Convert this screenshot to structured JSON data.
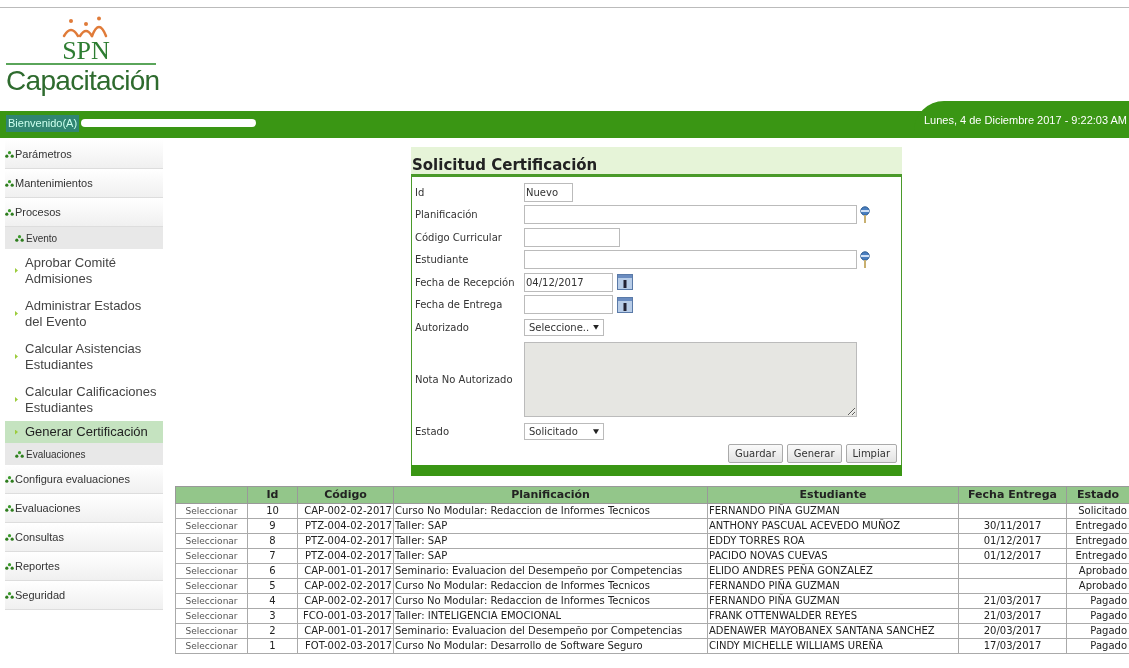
{
  "header": {
    "logo_mark": "SPN",
    "logo_title": "Capacitación",
    "welcome": "Bienvenido(A)",
    "date_time": "Lunes, 4 de Diciembre 2017 - 9:22:03 AM"
  },
  "sidebar": {
    "items": [
      {
        "label": "Parámetros",
        "kind": "group"
      },
      {
        "label": "Mantenimientos",
        "kind": "group"
      },
      {
        "label": "Procesos",
        "kind": "group",
        "children": [
          {
            "label": "Evento",
            "kind": "subgroup",
            "children": [
              {
                "label": "Aprobar Comité Admisiones",
                "kind": "leaf",
                "selected": false
              },
              {
                "label": "Administrar Estados del Evento",
                "kind": "leaf",
                "selected": false
              },
              {
                "label": "Calcular Asistencias Estudiantes",
                "kind": "leaf",
                "selected": false
              },
              {
                "label": "Calcular Calificaciones Estudiantes",
                "kind": "leaf",
                "selected": false
              },
              {
                "label": "Generar Certificación",
                "kind": "leaf",
                "selected": true
              }
            ]
          },
          {
            "label": "Evaluaciones",
            "kind": "subgroup"
          }
        ]
      },
      {
        "label": "Configura evaluaciones",
        "kind": "group"
      },
      {
        "label": "Evaluaciones",
        "kind": "group"
      },
      {
        "label": "Consultas",
        "kind": "group"
      },
      {
        "label": "Reportes",
        "kind": "group"
      },
      {
        "label": "Seguridad",
        "kind": "group"
      }
    ]
  },
  "form": {
    "title": "Solicitud Certificación",
    "fields": [
      {
        "label": "Id",
        "kind": "short",
        "value": "Nuevo"
      },
      {
        "label": "Planificación",
        "kind": "lookup"
      },
      {
        "label": "Código Curricular",
        "kind": "medium"
      },
      {
        "label": "Estudiante",
        "kind": "lookup"
      },
      {
        "label": "Fecha de Recepción",
        "kind": "date",
        "value": "04/12/2017"
      },
      {
        "label": "Fecha de Entrega",
        "kind": "date"
      },
      {
        "label": "Autorizado",
        "kind": "select",
        "value": "Seleccione.."
      },
      {
        "label": "Nota No Autorizado",
        "kind": "textarea",
        "disabled": true
      },
      {
        "label": "Estado",
        "kind": "select",
        "value": "Solicitado"
      }
    ],
    "buttons": [
      "Guardar",
      "Generar",
      "Limpiar"
    ]
  },
  "table": {
    "columns": [
      "Id",
      "Código",
      "Planificación",
      "Estudiante",
      "Fecha Entrega",
      "Estado"
    ],
    "rows": [
      {
        "action": "Seleccionar",
        "cells": [
          "10",
          "CAP-002-02-2017",
          "Curso No Modular: Redaccion de Informes Tecnicos",
          "FERNANDO PIÑA GUZMAN",
          "",
          "Solicitado"
        ]
      },
      {
        "action": "Seleccionar",
        "cells": [
          "9",
          "PTZ-004-02-2017",
          "Taller: SAP",
          "ANTHONY PASCUAL ACEVEDO MUÑOZ",
          "30/11/2017",
          "Entregado"
        ]
      },
      {
        "action": "Seleccionar",
        "cells": [
          "8",
          "PTZ-004-02-2017",
          "Taller: SAP",
          "EDDY TORRES ROA",
          "01/12/2017",
          "Entregado"
        ]
      },
      {
        "action": "Seleccionar",
        "cells": [
          "7",
          "PTZ-004-02-2017",
          "Taller: SAP",
          "PACIDO NOVAS CUEVAS",
          "01/12/2017",
          "Entregado"
        ]
      },
      {
        "action": "Seleccionar",
        "cells": [
          "6",
          "CAP-001-01-2017",
          "Seminario: Evaluacion del Desempeño por Competencias",
          "ELIDO ANDRES PEÑA GONZALEZ",
          "",
          "Aprobado"
        ]
      },
      {
        "action": "Seleccionar",
        "cells": [
          "5",
          "CAP-002-02-2017",
          "Curso No Modular: Redaccion de Informes Tecnicos",
          "FERNANDO PIÑA GUZMAN",
          "",
          "Aprobado"
        ]
      },
      {
        "action": "Seleccionar",
        "cells": [
          "4",
          "CAP-002-02-2017",
          "Curso No Modular: Redaccion de Informes Tecnicos",
          "FERNANDO PIÑA GUZMAN",
          "21/03/2017",
          "Pagado"
        ]
      },
      {
        "action": "Seleccionar",
        "cells": [
          "3",
          "FCO-001-03-2017",
          "Taller: INTELIGENCIA EMOCIONAL",
          "FRANK OTTENWALDER REYES",
          "21/03/2017",
          "Pagado"
        ]
      },
      {
        "action": "Seleccionar",
        "cells": [
          "2",
          "CAP-001-01-2017",
          "Seminario: Evaluacion del Desempeño por Competencias",
          "ADENAWER MAYOBANEX SANTANA SANCHEZ",
          "20/03/2017",
          "Pagado"
        ]
      },
      {
        "action": "Seleccionar",
        "cells": [
          "1",
          "FOT-002-03-2017",
          "Curso No Modular: Desarrollo de Software Seguro",
          "CINDY MICHELLE WILLIAMS UREÑA",
          "17/03/2017",
          "Pagado"
        ]
      }
    ]
  }
}
